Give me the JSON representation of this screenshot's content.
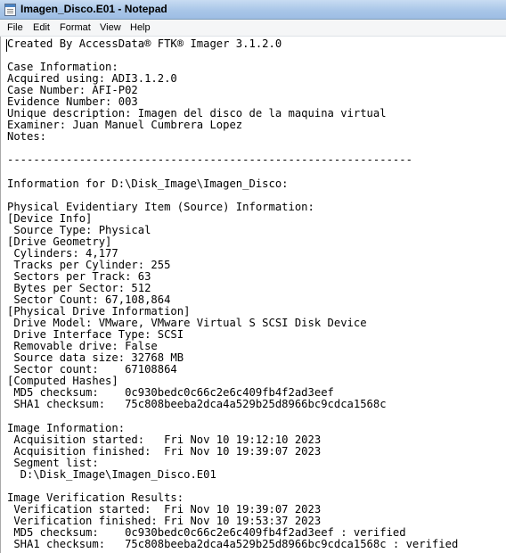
{
  "window": {
    "title": "Imagen_Disco.E01 - Notepad"
  },
  "icons": {
    "app": "notepad-icon"
  },
  "menu": {
    "items": [
      "File",
      "Edit",
      "Format",
      "View",
      "Help"
    ]
  },
  "document": {
    "text": "Created By AccessData® FTK® Imager 3.1.2.0\n\nCase Information:\nAcquired using: ADI3.1.2.0\nCase Number: AFI-P02\nEvidence Number: 003\nUnique description: Imagen del disco de la maquina virtual\nExaminer: Juan Manuel Cumbrera Lopez\nNotes:\n\n--------------------------------------------------------------\n\nInformation for D:\\Disk_Image\\Imagen_Disco:\n\nPhysical Evidentiary Item (Source) Information:\n[Device Info]\n Source Type: Physical\n[Drive Geometry]\n Cylinders: 4,177\n Tracks per Cylinder: 255\n Sectors per Track: 63\n Bytes per Sector: 512\n Sector Count: 67,108,864\n[Physical Drive Information]\n Drive Model: VMware, VMware Virtual S SCSI Disk Device\n Drive Interface Type: SCSI\n Removable drive: False\n Source data size: 32768 MB\n Sector count:    67108864\n[Computed Hashes]\n MD5 checksum:    0c930bedc0c66c2e6c409fb4f2ad3eef\n SHA1 checksum:   75c808beeba2dca4a529b25d8966bc9cdca1568c\n\nImage Information:\n Acquisition started:   Fri Nov 10 19:12:10 2023\n Acquisition finished:  Fri Nov 10 19:39:07 2023\n Segment list:\n  D:\\Disk_Image\\Imagen_Disco.E01\n\nImage Verification Results:\n Verification started:  Fri Nov 10 19:39:07 2023\n Verification finished: Fri Nov 10 19:53:37 2023\n MD5 checksum:    0c930bedc0c66c2e6c409fb4f2ad3eef : verified\n SHA1 checksum:   75c808beeba2dca4a529b25d8966bc9cdca1568c : verified"
  }
}
